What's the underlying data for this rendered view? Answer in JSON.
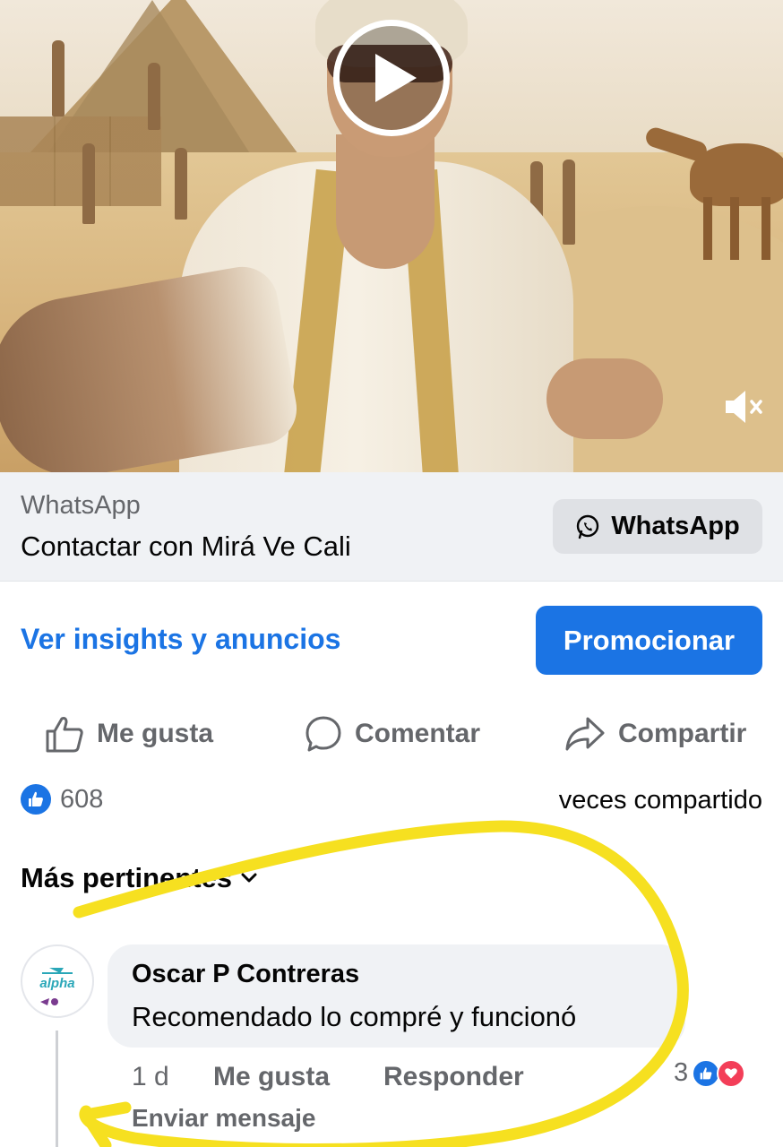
{
  "video": {
    "play_icon": "play-icon",
    "mute_icon": "speaker-muted-icon"
  },
  "cta": {
    "subtitle": "WhatsApp",
    "title": "Contactar con Mirá Ve Cali",
    "button_label": "WhatsApp",
    "button_icon": "whatsapp-icon"
  },
  "insights": {
    "link_label": "Ver insights y anuncios",
    "promote_label": "Promocionar"
  },
  "actions": {
    "like_label": "Me gusta",
    "comment_label": "Comentar",
    "share_label": "Compartir"
  },
  "stats": {
    "likes_count": "608",
    "shares_text": "veces compartido"
  },
  "comments": {
    "filter_label": "Más pertinentes",
    "items": [
      {
        "author": "Oscar P Contreras",
        "avatar_text": "alpha",
        "text": "Recomendado lo compré y funcionó",
        "time": "1 d",
        "like_label": "Me gusta",
        "reply_label": "Responder",
        "reaction_count": "3",
        "message_label": "Enviar mensaje"
      }
    ]
  },
  "colors": {
    "accent": "#1b74e4",
    "secondary_text": "#65676b",
    "highlight_scribble": "#f6e020",
    "love_reaction": "#f33e58"
  }
}
